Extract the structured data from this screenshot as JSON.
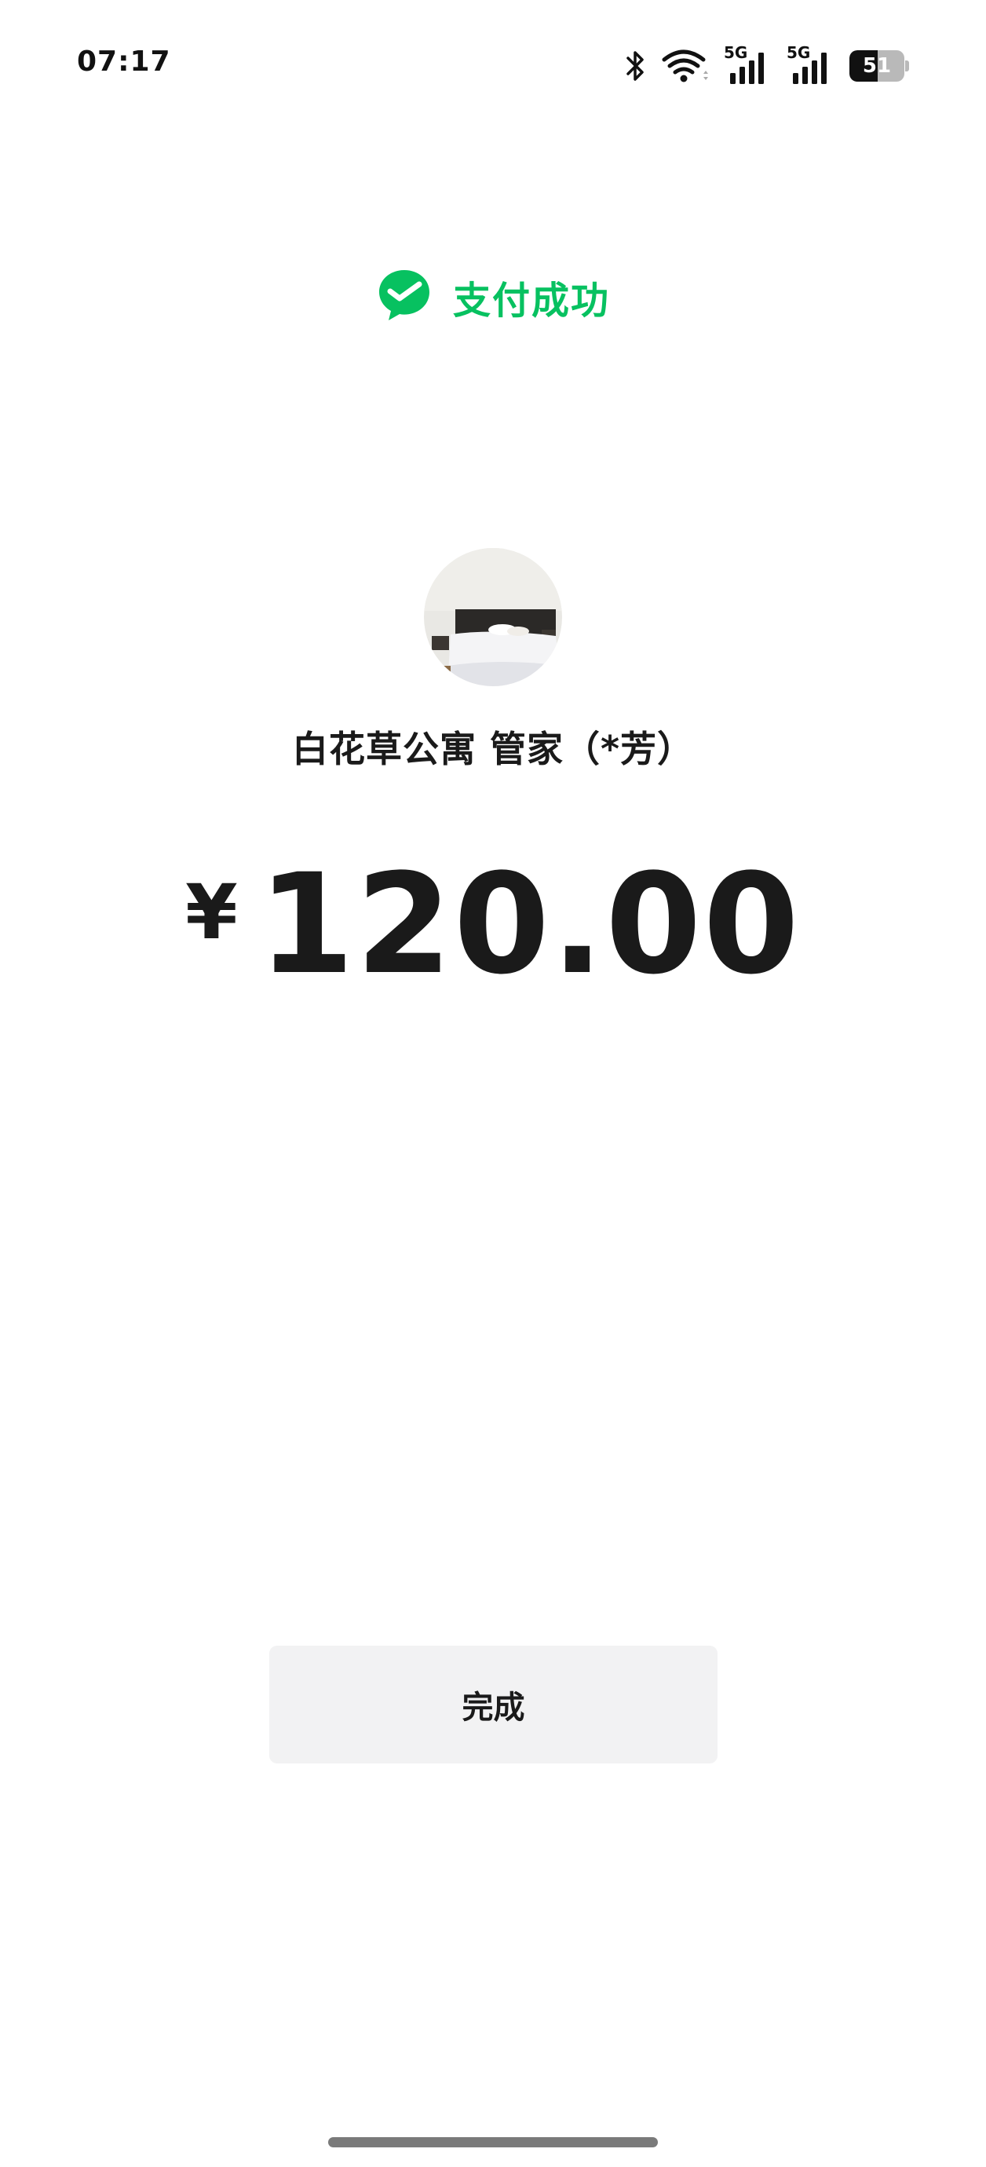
{
  "status_bar": {
    "time": "07:17",
    "network_1": "5G",
    "network_2": "5G",
    "battery_percent": "51",
    "battery_level": 0.51,
    "icons": [
      "bluetooth-icon",
      "wifi-icon",
      "signal-5g-icon",
      "signal-5g-icon",
      "battery-icon"
    ]
  },
  "header": {
    "status_text": "支付成功",
    "icon": "wechat-pay-icon",
    "accent_color": "#07c160"
  },
  "payee": {
    "avatar": "room-photo-avatar",
    "name": "白花草公寓 管家（*芳）"
  },
  "payment": {
    "currency_symbol": "¥",
    "amount": "120.00"
  },
  "actions": {
    "done_label": "完成"
  }
}
